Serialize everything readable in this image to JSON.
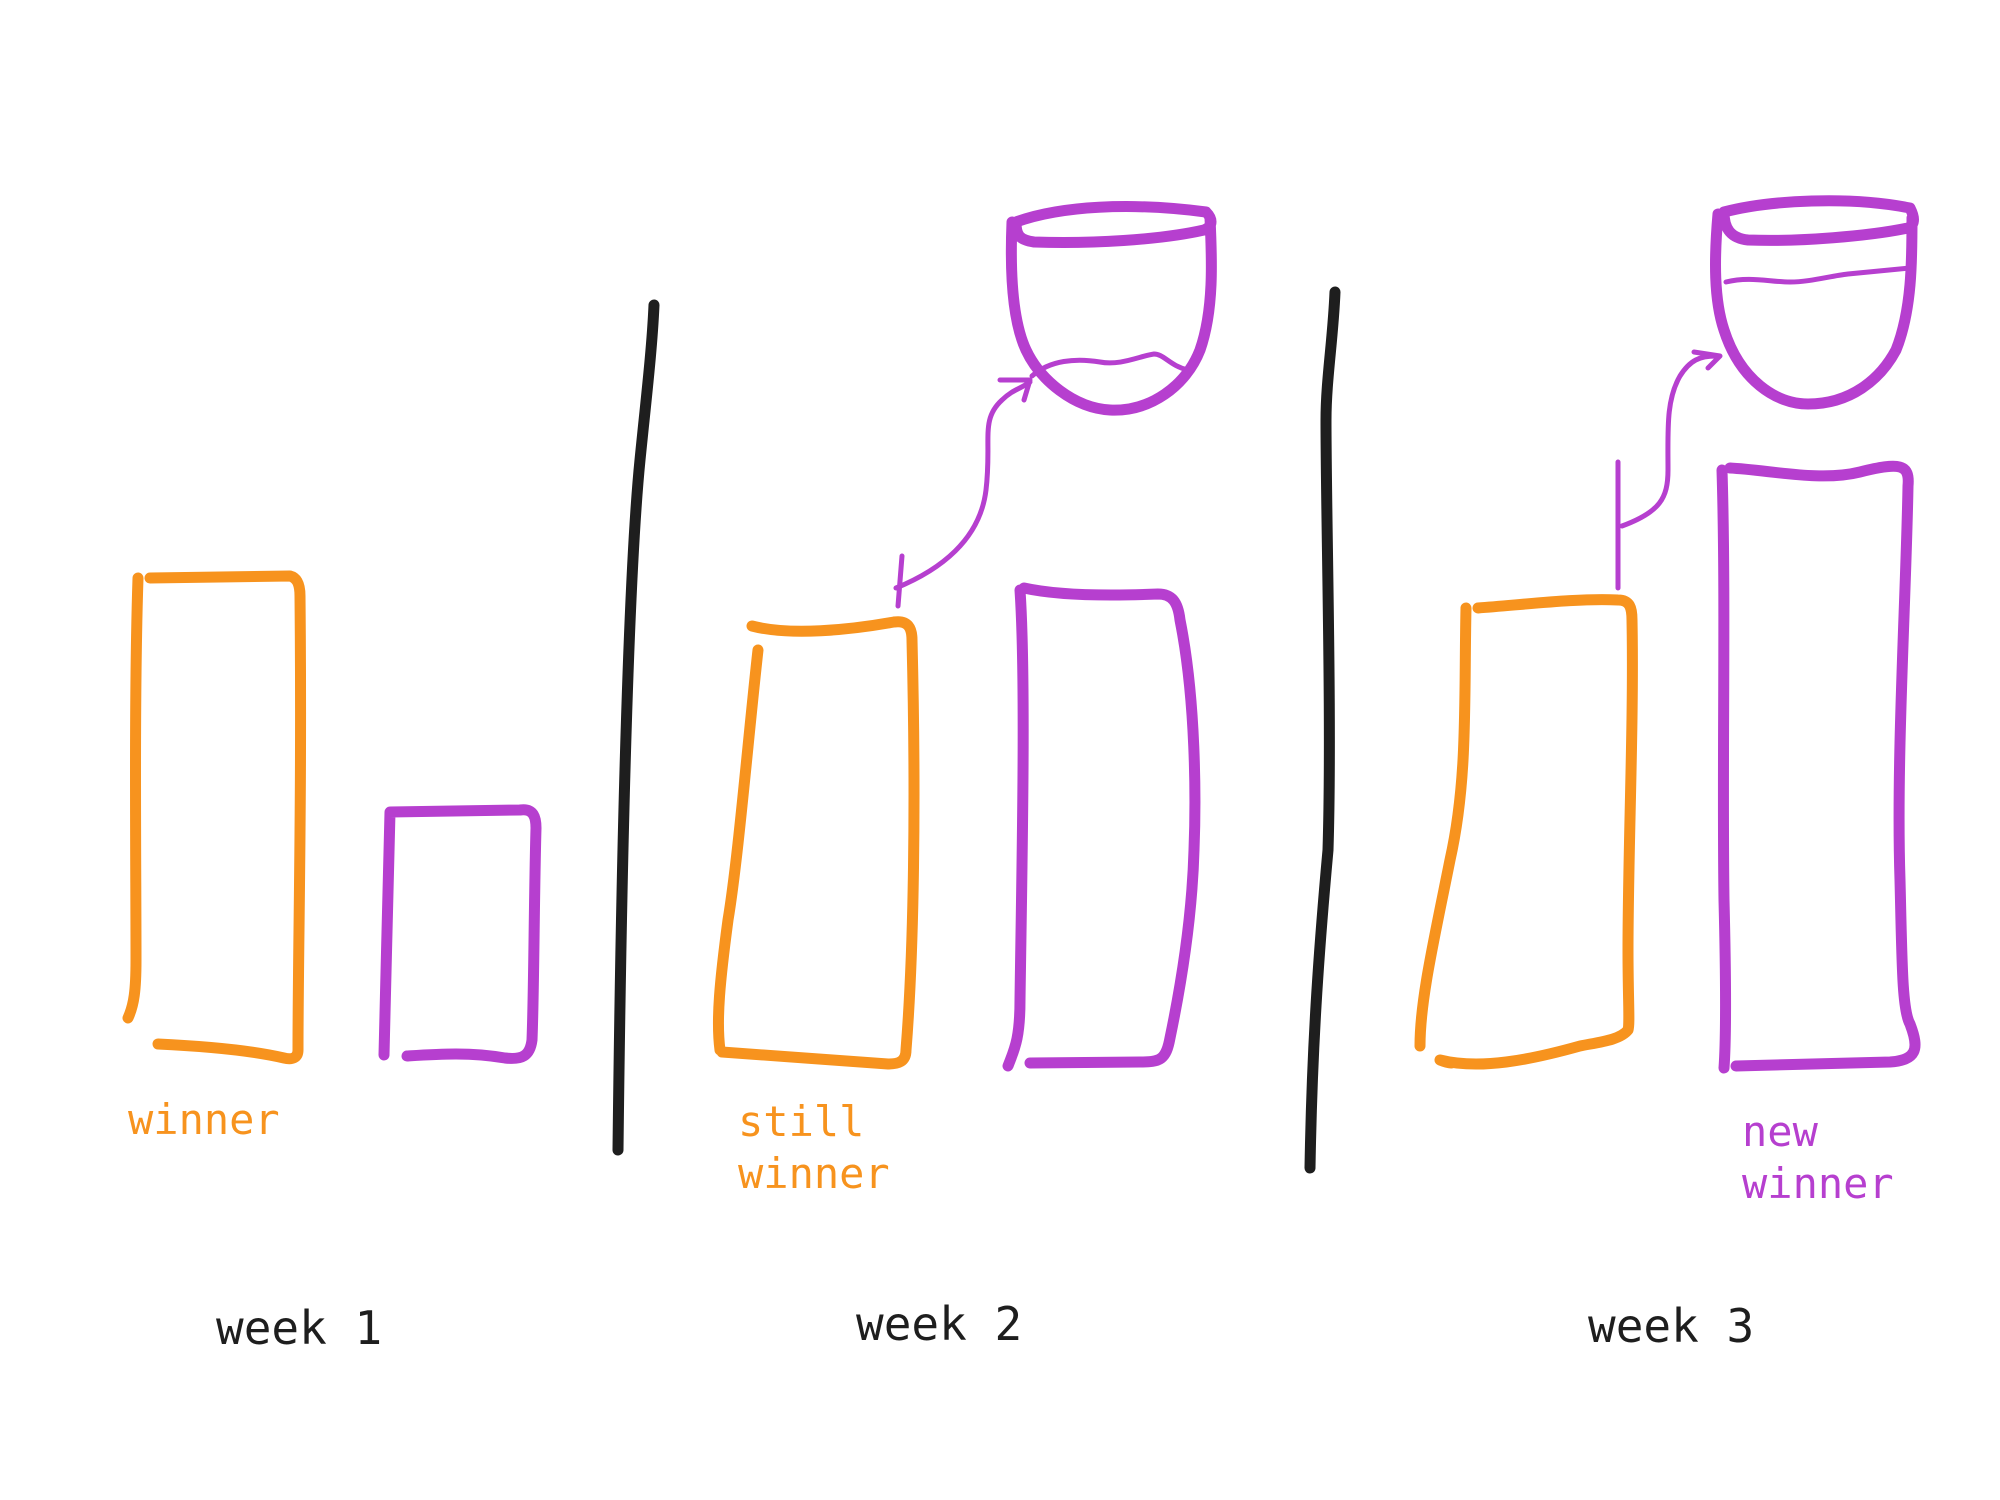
{
  "colors": {
    "series_a": "#F7931E",
    "series_b": "#B63FCF",
    "divider": "#1E1E1E",
    "text": "#1E1E1E"
  },
  "panels": [
    {
      "week_label": "week 1",
      "annotation_lines": [
        "winner"
      ],
      "annotation_color": "#F7931E"
    },
    {
      "week_label": "week 2",
      "annotation_lines": [
        "still",
        "winner"
      ],
      "annotation_color": "#F7931E"
    },
    {
      "week_label": "week 3",
      "annotation_lines": [
        "new",
        "winner"
      ],
      "annotation_color": "#B63FCF"
    }
  ],
  "icons": [
    "bucket-icon",
    "arrow-icon"
  ]
}
